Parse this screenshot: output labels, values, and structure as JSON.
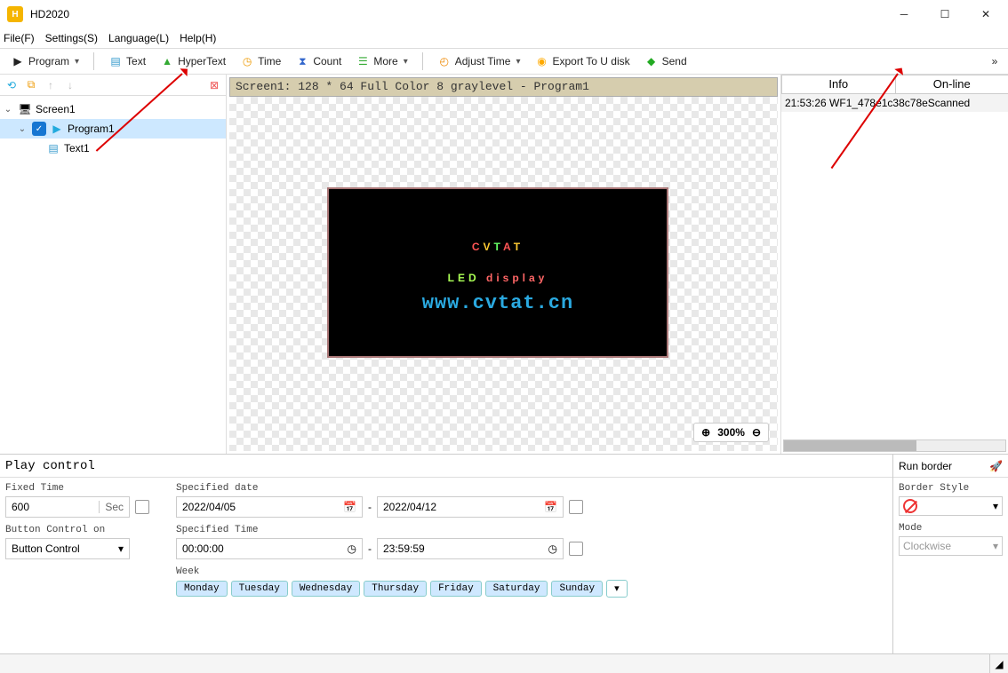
{
  "title": "HD2020",
  "menubar": [
    "File(F)",
    "Settings(S)",
    "Language(L)",
    "Help(H)"
  ],
  "toolbar": {
    "program": "Program",
    "text": "Text",
    "hypertext": "HyperText",
    "time": "Time",
    "count": "Count",
    "more": "More",
    "adjust": "Adjust Time",
    "export": "Export To U disk",
    "send": "Send"
  },
  "tree": {
    "root": "Screen1",
    "program": "Program1",
    "text": "Text1"
  },
  "canvas_header": "Screen1: 128 * 64 Full Color 8 graylevel - Program1",
  "led": {
    "line1": "CVTAT",
    "line2a": "LED ",
    "line2b": "display",
    "line3": "www.cvtat.cn"
  },
  "zoom": "300%",
  "right_tabs": {
    "info": "Info",
    "online": "On-line"
  },
  "log_entry": "21:53:26 WF1_478e1c38c78eScanned",
  "play": {
    "header": "Play control",
    "fixed_time_label": "Fixed Time",
    "fixed_time_value": "600",
    "fixed_time_unit": "Sec",
    "button_ctrl_label": "Button Control on",
    "button_ctrl_value": "Button Control",
    "spec_date_label": "Specified date",
    "date_from": "2022/04/05",
    "date_to": "2022/04/12",
    "spec_time_label": "Specified Time",
    "time_from": "00:00:00",
    "time_to": "23:59:59",
    "week_label": "Week",
    "days": [
      "Monday",
      "Tuesday",
      "Wednesday",
      "Thursday",
      "Friday",
      "Saturday",
      "Sunday"
    ]
  },
  "run": {
    "header": "Run border",
    "style_label": "Border Style",
    "mode_label": "Mode",
    "mode_value": "Clockwise"
  }
}
